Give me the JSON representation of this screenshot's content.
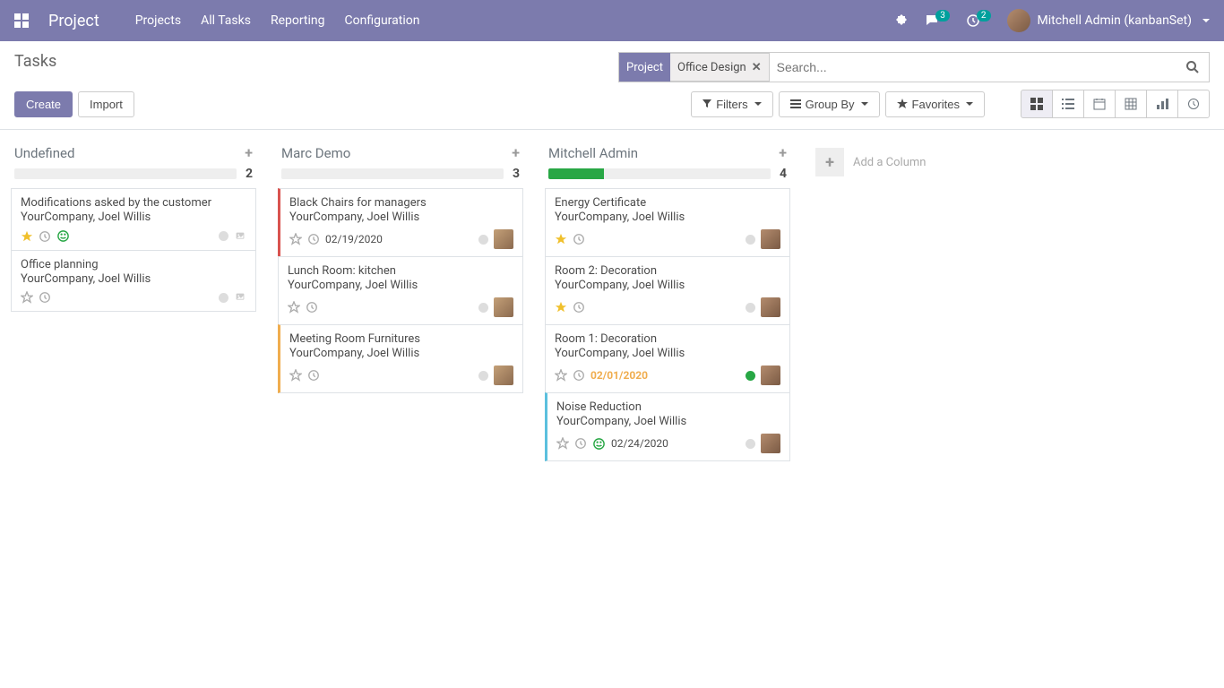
{
  "topbar": {
    "brand": "Project",
    "nav": [
      "Projects",
      "All Tasks",
      "Reporting",
      "Configuration"
    ],
    "messages_badge": "3",
    "activities_badge": "2",
    "user_label": "Mitchell Admin (kanbanSet)"
  },
  "control": {
    "title": "Tasks",
    "create": "Create",
    "import": "Import",
    "search_placeholder": "Search...",
    "facet_label": "Project",
    "facet_value": "Office Design",
    "filters": "Filters",
    "groupby": "Group By",
    "favorites": "Favorites"
  },
  "kanban": {
    "add_column_label": "Add a Column",
    "columns": [
      {
        "title": "Undefined",
        "count": "2",
        "progress": [],
        "cards": [
          {
            "title": "Modifications asked by the customer",
            "subtitle": "YourCompany, Joel Willis",
            "star": true,
            "smile": true,
            "date": "",
            "date_overdue": false,
            "state": "grey",
            "avatar": "none",
            "attach": true,
            "border": ""
          },
          {
            "title": "Office planning",
            "subtitle": "YourCompany, Joel Willis",
            "star": false,
            "smile": false,
            "date": "",
            "date_overdue": false,
            "state": "grey",
            "avatar": "none",
            "attach": true,
            "border": ""
          }
        ]
      },
      {
        "title": "Marc Demo",
        "count": "3",
        "progress": [],
        "cards": [
          {
            "title": "Black Chairs for managers",
            "subtitle": "YourCompany, Joel Willis",
            "star": false,
            "smile": false,
            "date": "02/19/2020",
            "date_overdue": false,
            "state": "grey",
            "avatar": "marc",
            "attach": false,
            "border": "red"
          },
          {
            "title": "Lunch Room: kitchen",
            "subtitle": "YourCompany, Joel Willis",
            "star": false,
            "smile": false,
            "date": "",
            "date_overdue": false,
            "state": "grey",
            "avatar": "marc",
            "attach": false,
            "border": ""
          },
          {
            "title": "Meeting Room Furnitures",
            "subtitle": "YourCompany, Joel Willis",
            "star": false,
            "smile": false,
            "date": "",
            "date_overdue": false,
            "state": "grey",
            "avatar": "marc",
            "attach": false,
            "border": "yellow"
          }
        ]
      },
      {
        "title": "Mitchell Admin",
        "count": "4",
        "progress": [
          {
            "color": "#28a745",
            "width": 25
          }
        ],
        "cards": [
          {
            "title": "Energy Certificate",
            "subtitle": "YourCompany, Joel Willis",
            "star": true,
            "smile": false,
            "date": "",
            "date_overdue": false,
            "state": "grey",
            "avatar": "mitchell",
            "attach": false,
            "border": ""
          },
          {
            "title": "Room 2: Decoration",
            "subtitle": "YourCompany, Joel Willis",
            "star": true,
            "smile": false,
            "date": "",
            "date_overdue": false,
            "state": "grey",
            "avatar": "mitchell",
            "attach": false,
            "border": ""
          },
          {
            "title": "Room 1: Decoration",
            "subtitle": "YourCompany, Joel Willis",
            "star": false,
            "smile": false,
            "date": "02/01/2020",
            "date_overdue": true,
            "state": "green",
            "avatar": "mitchell",
            "attach": false,
            "border": ""
          },
          {
            "title": "Noise Reduction",
            "subtitle": "YourCompany, Joel Willis",
            "star": false,
            "smile": true,
            "date": "02/24/2020",
            "date_overdue": false,
            "state": "grey",
            "avatar": "mitchell",
            "attach": false,
            "border": "blue"
          }
        ]
      }
    ]
  }
}
